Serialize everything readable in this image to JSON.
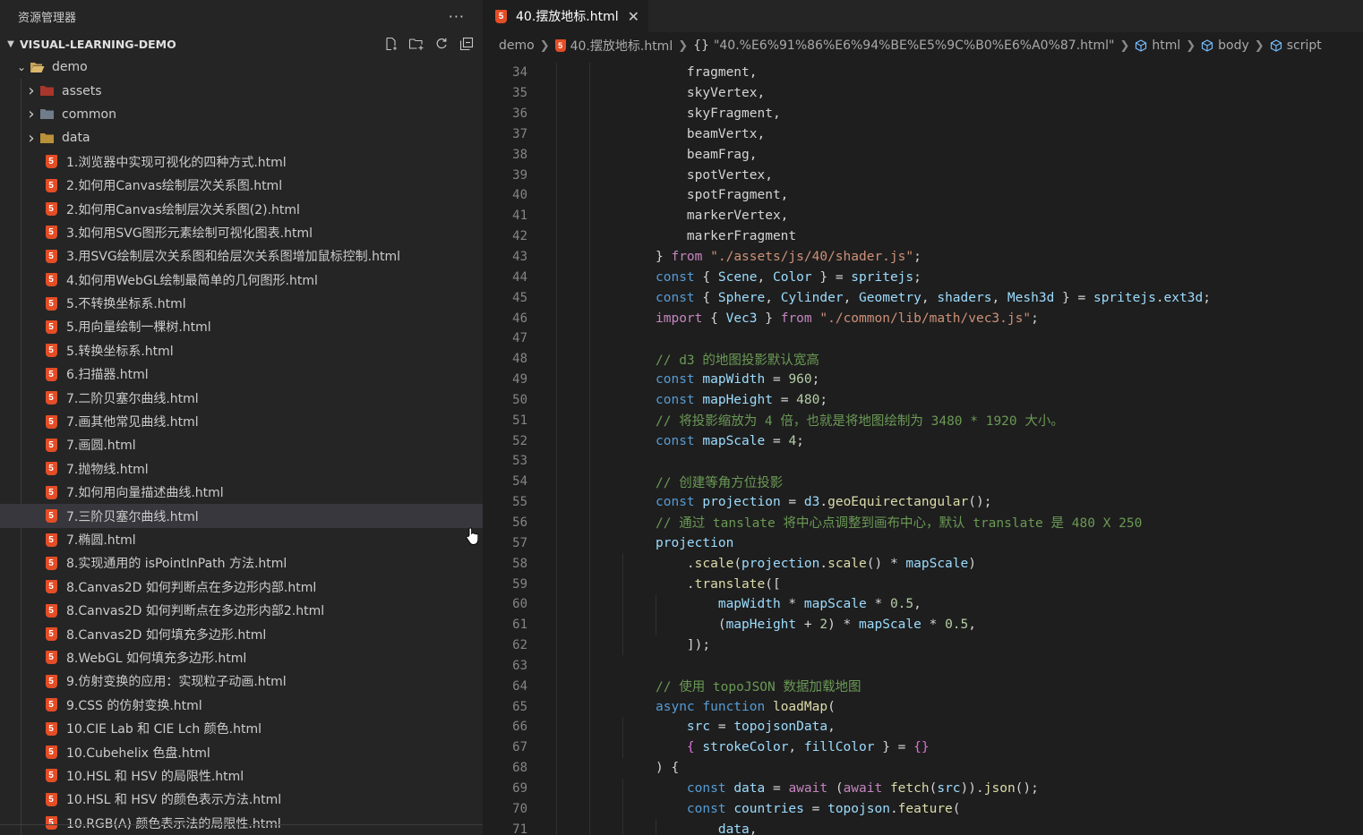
{
  "sidebar": {
    "title": "资源管理器",
    "more": "···",
    "section": "VISUAL-LEARNING-DEMO",
    "folder": "demo",
    "subfolders": [
      {
        "label": "assets",
        "color": "#c0392b"
      },
      {
        "label": "common",
        "color": "#7f8c9d"
      },
      {
        "label": "data",
        "color": "#d4a53c"
      }
    ],
    "files": [
      "1.浏览器中实现可视化的四种方式.html",
      "2.如何用Canvas绘制层次关系图.html",
      "2.如何用Canvas绘制层次关系图(2).html",
      "3.如何用SVG图形元素绘制可视化图表.html",
      "3.用SVG绘制层次关系图和给层次关系图增加鼠标控制.html",
      "4.如何用WebGL绘制最简单的几何图形.html",
      "5.不转换坐标系.html",
      "5.用向量绘制一棵树.html",
      "5.转换坐标系.html",
      "6.扫描器.html",
      "7.二阶贝塞尔曲线.html",
      "7.画其他常见曲线.html",
      "7.画圆.html",
      "7.抛物线.html",
      "7.如何用向量描述曲线.html",
      "7.三阶贝塞尔曲线.html",
      "7.椭圆.html",
      "8.实现通用的 isPointInPath 方法.html",
      "8.Canvas2D 如何判断点在多边形内部.html",
      "8.Canvas2D 如何判断点在多边形内部2.html",
      "8.Canvas2D 如何填充多边形.html",
      "8.WebGL 如何填充多边形.html",
      "9.仿射变换的应用：实现粒子动画.html",
      "9.CSS 的仿射变换.html",
      "10.CIE Lab 和 CIE Lch 颜色.html",
      "10.Cubehelix 色盘.html",
      "10.HSL 和 HSV 的局限性.html",
      "10.HSL 和 HSV 的颜色表示方法.html",
      "10.RGB(A) 颜色表示法的局限性.html"
    ],
    "selected_index": 15,
    "html_badge": "5"
  },
  "editor": {
    "tab": "40.摆放地标.html",
    "tab_close": "✕",
    "breadcrumb": {
      "root": "demo",
      "file": "40.摆放地标.html",
      "obj": "\"40.%E6%91%86%E6%94%BE%E5%9C%B0%E6%A0%87.html\"",
      "obj_prefix": "{}",
      "html": "html",
      "body": "body",
      "script": "script"
    }
  },
  "code": [
    {
      "n": "34",
      "indent": 2,
      "t": [
        [
          "    fragment,",
          "p"
        ]
      ]
    },
    {
      "n": "35",
      "indent": 2,
      "t": [
        [
          "    skyVertex,",
          "p"
        ]
      ]
    },
    {
      "n": "36",
      "indent": 2,
      "t": [
        [
          "    skyFragment,",
          "p"
        ]
      ]
    },
    {
      "n": "37",
      "indent": 2,
      "t": [
        [
          "    beamVertx,",
          "p"
        ]
      ]
    },
    {
      "n": "38",
      "indent": 2,
      "t": [
        [
          "    beamFrag,",
          "p"
        ]
      ]
    },
    {
      "n": "39",
      "indent": 2,
      "t": [
        [
          "    spotVertex,",
          "p"
        ]
      ]
    },
    {
      "n": "40",
      "indent": 2,
      "t": [
        [
          "    spotFragment,",
          "p"
        ]
      ]
    },
    {
      "n": "41",
      "indent": 2,
      "t": [
        [
          "    markerVertex,",
          "p"
        ]
      ]
    },
    {
      "n": "42",
      "indent": 2,
      "t": [
        [
          "    markerFragment",
          "p"
        ]
      ]
    },
    {
      "n": "43",
      "indent": 2,
      "t": [
        [
          "} ",
          "p"
        ],
        [
          "from",
          "k"
        ],
        [
          " ",
          "p"
        ],
        [
          "\"./assets/js/40/shader.js\"",
          "s"
        ],
        [
          ";",
          "p"
        ]
      ]
    },
    {
      "n": "44",
      "indent": 2,
      "t": [
        [
          "const",
          "d"
        ],
        [
          " { ",
          "p"
        ],
        [
          "Scene",
          "v"
        ],
        [
          ", ",
          "p"
        ],
        [
          "Color",
          "v"
        ],
        [
          " } = ",
          "p"
        ],
        [
          "spritejs",
          "v"
        ],
        [
          ";",
          "p"
        ]
      ]
    },
    {
      "n": "45",
      "indent": 2,
      "t": [
        [
          "const",
          "d"
        ],
        [
          " { ",
          "p"
        ],
        [
          "Sphere",
          "v"
        ],
        [
          ", ",
          "p"
        ],
        [
          "Cylinder",
          "v"
        ],
        [
          ", ",
          "p"
        ],
        [
          "Geometry",
          "v"
        ],
        [
          ", ",
          "p"
        ],
        [
          "shaders",
          "v"
        ],
        [
          ", ",
          "p"
        ],
        [
          "Mesh3d",
          "v"
        ],
        [
          " } = ",
          "p"
        ],
        [
          "spritejs",
          "v"
        ],
        [
          ".",
          "p"
        ],
        [
          "ext3d",
          "v"
        ],
        [
          ";",
          "p"
        ]
      ]
    },
    {
      "n": "46",
      "indent": 2,
      "t": [
        [
          "import",
          "k"
        ],
        [
          " { ",
          "p"
        ],
        [
          "Vec3",
          "v"
        ],
        [
          " } ",
          "p"
        ],
        [
          "from",
          "k"
        ],
        [
          " ",
          "p"
        ],
        [
          "\"./common/lib/math/vec3.js\"",
          "s"
        ],
        [
          ";",
          "p"
        ]
      ]
    },
    {
      "n": "47",
      "indent": 2,
      "t": [
        [
          "",
          "p"
        ]
      ]
    },
    {
      "n": "48",
      "indent": 2,
      "t": [
        [
          "// d3 的地图投影默认宽高",
          "c"
        ]
      ]
    },
    {
      "n": "49",
      "indent": 2,
      "t": [
        [
          "const",
          "d"
        ],
        [
          " ",
          "p"
        ],
        [
          "mapWidth",
          "v"
        ],
        [
          " = ",
          "p"
        ],
        [
          "960",
          "n"
        ],
        [
          ";",
          "p"
        ]
      ]
    },
    {
      "n": "50",
      "indent": 2,
      "t": [
        [
          "const",
          "d"
        ],
        [
          " ",
          "p"
        ],
        [
          "mapHeight",
          "v"
        ],
        [
          " = ",
          "p"
        ],
        [
          "480",
          "n"
        ],
        [
          ";",
          "p"
        ]
      ]
    },
    {
      "n": "51",
      "indent": 2,
      "t": [
        [
          "// 将投影缩放为 4 倍，也就是将地图绘制为 3480 * 1920 大小。",
          "c"
        ]
      ]
    },
    {
      "n": "52",
      "indent": 2,
      "t": [
        [
          "const",
          "d"
        ],
        [
          " ",
          "p"
        ],
        [
          "mapScale",
          "v"
        ],
        [
          " = ",
          "p"
        ],
        [
          "4",
          "n"
        ],
        [
          ";",
          "p"
        ]
      ]
    },
    {
      "n": "53",
      "indent": 2,
      "t": [
        [
          "",
          "p"
        ]
      ]
    },
    {
      "n": "54",
      "indent": 2,
      "t": [
        [
          "// 创建等角方位投影",
          "c"
        ]
      ]
    },
    {
      "n": "55",
      "indent": 2,
      "t": [
        [
          "const",
          "d"
        ],
        [
          " ",
          "p"
        ],
        [
          "projection",
          "v"
        ],
        [
          " = ",
          "p"
        ],
        [
          "d3",
          "v"
        ],
        [
          ".",
          "p"
        ],
        [
          "geoEquirectangular",
          "f"
        ],
        [
          "();",
          "p"
        ]
      ]
    },
    {
      "n": "56",
      "indent": 2,
      "t": [
        [
          "// 通过 tanslate 将中心点调整到画布中心，默认 translate 是 480 X 250",
          "c"
        ]
      ]
    },
    {
      "n": "57",
      "indent": 2,
      "t": [
        [
          "projection",
          "v"
        ]
      ]
    },
    {
      "n": "58",
      "indent": 3,
      "t": [
        [
          "    .",
          "p"
        ],
        [
          "scale",
          "f"
        ],
        [
          "(",
          "p"
        ],
        [
          "projection",
          "v"
        ],
        [
          ".",
          "p"
        ],
        [
          "scale",
          "f"
        ],
        [
          "() * ",
          "p"
        ],
        [
          "mapScale",
          "v"
        ],
        [
          ")",
          "p"
        ]
      ]
    },
    {
      "n": "59",
      "indent": 3,
      "t": [
        [
          "    .",
          "p"
        ],
        [
          "translate",
          "f"
        ],
        [
          "([",
          "p"
        ]
      ]
    },
    {
      "n": "60",
      "indent": 4,
      "t": [
        [
          "        ",
          "p"
        ],
        [
          "mapWidth",
          "v"
        ],
        [
          " * ",
          "p"
        ],
        [
          "mapScale",
          "v"
        ],
        [
          " * ",
          "p"
        ],
        [
          "0.5",
          "n"
        ],
        [
          ",",
          "p"
        ]
      ]
    },
    {
      "n": "61",
      "indent": 4,
      "t": [
        [
          "        (",
          "p"
        ],
        [
          "mapHeight",
          "v"
        ],
        [
          " + ",
          "p"
        ],
        [
          "2",
          "n"
        ],
        [
          ") * ",
          "p"
        ],
        [
          "mapScale",
          "v"
        ],
        [
          " * ",
          "p"
        ],
        [
          "0.5",
          "n"
        ],
        [
          ",",
          "p"
        ]
      ]
    },
    {
      "n": "62",
      "indent": 3,
      "t": [
        [
          "    ]);",
          "p"
        ]
      ]
    },
    {
      "n": "63",
      "indent": 2,
      "t": [
        [
          "",
          "p"
        ]
      ]
    },
    {
      "n": "64",
      "indent": 2,
      "t": [
        [
          "// 使用 topoJSON 数据加载地图",
          "c"
        ]
      ]
    },
    {
      "n": "65",
      "indent": 2,
      "t": [
        [
          "async",
          "d"
        ],
        [
          " ",
          "p"
        ],
        [
          "function",
          "d"
        ],
        [
          " ",
          "p"
        ],
        [
          "loadMap",
          "f"
        ],
        [
          "(",
          "p"
        ]
      ]
    },
    {
      "n": "66",
      "indent": 3,
      "t": [
        [
          "    ",
          "p"
        ],
        [
          "src",
          "v"
        ],
        [
          " = ",
          "p"
        ],
        [
          "topojsonData",
          "v"
        ],
        [
          ",",
          "p"
        ]
      ]
    },
    {
      "n": "67",
      "indent": 3,
      "t": [
        [
          "    { ",
          "m"
        ],
        [
          "strokeColor",
          "v"
        ],
        [
          ", ",
          "p"
        ],
        [
          "fillColor",
          "v"
        ],
        [
          " } = ",
          "p"
        ],
        [
          "{}",
          "m"
        ]
      ]
    },
    {
      "n": "68",
      "indent": 2,
      "t": [
        [
          ") {",
          "p"
        ]
      ]
    },
    {
      "n": "69",
      "indent": 3,
      "t": [
        [
          "    ",
          "p"
        ],
        [
          "const",
          "d"
        ],
        [
          " ",
          "p"
        ],
        [
          "data",
          "v"
        ],
        [
          " = ",
          "p"
        ],
        [
          "await",
          "k"
        ],
        [
          " (",
          "p"
        ],
        [
          "await",
          "k"
        ],
        [
          " ",
          "p"
        ],
        [
          "fetch",
          "f"
        ],
        [
          "(",
          "p"
        ],
        [
          "src",
          "v"
        ],
        [
          ")).",
          "p"
        ],
        [
          "json",
          "f"
        ],
        [
          "();",
          "p"
        ]
      ]
    },
    {
      "n": "70",
      "indent": 3,
      "t": [
        [
          "    ",
          "p"
        ],
        [
          "const",
          "d"
        ],
        [
          " ",
          "p"
        ],
        [
          "countries",
          "v"
        ],
        [
          " = ",
          "p"
        ],
        [
          "topojson",
          "v"
        ],
        [
          ".",
          "p"
        ],
        [
          "feature",
          "f"
        ],
        [
          "(",
          "p"
        ]
      ]
    },
    {
      "n": "71",
      "indent": 4,
      "t": [
        [
          "        ",
          "p"
        ],
        [
          "data",
          "v"
        ],
        [
          ",",
          "p"
        ]
      ]
    }
  ]
}
